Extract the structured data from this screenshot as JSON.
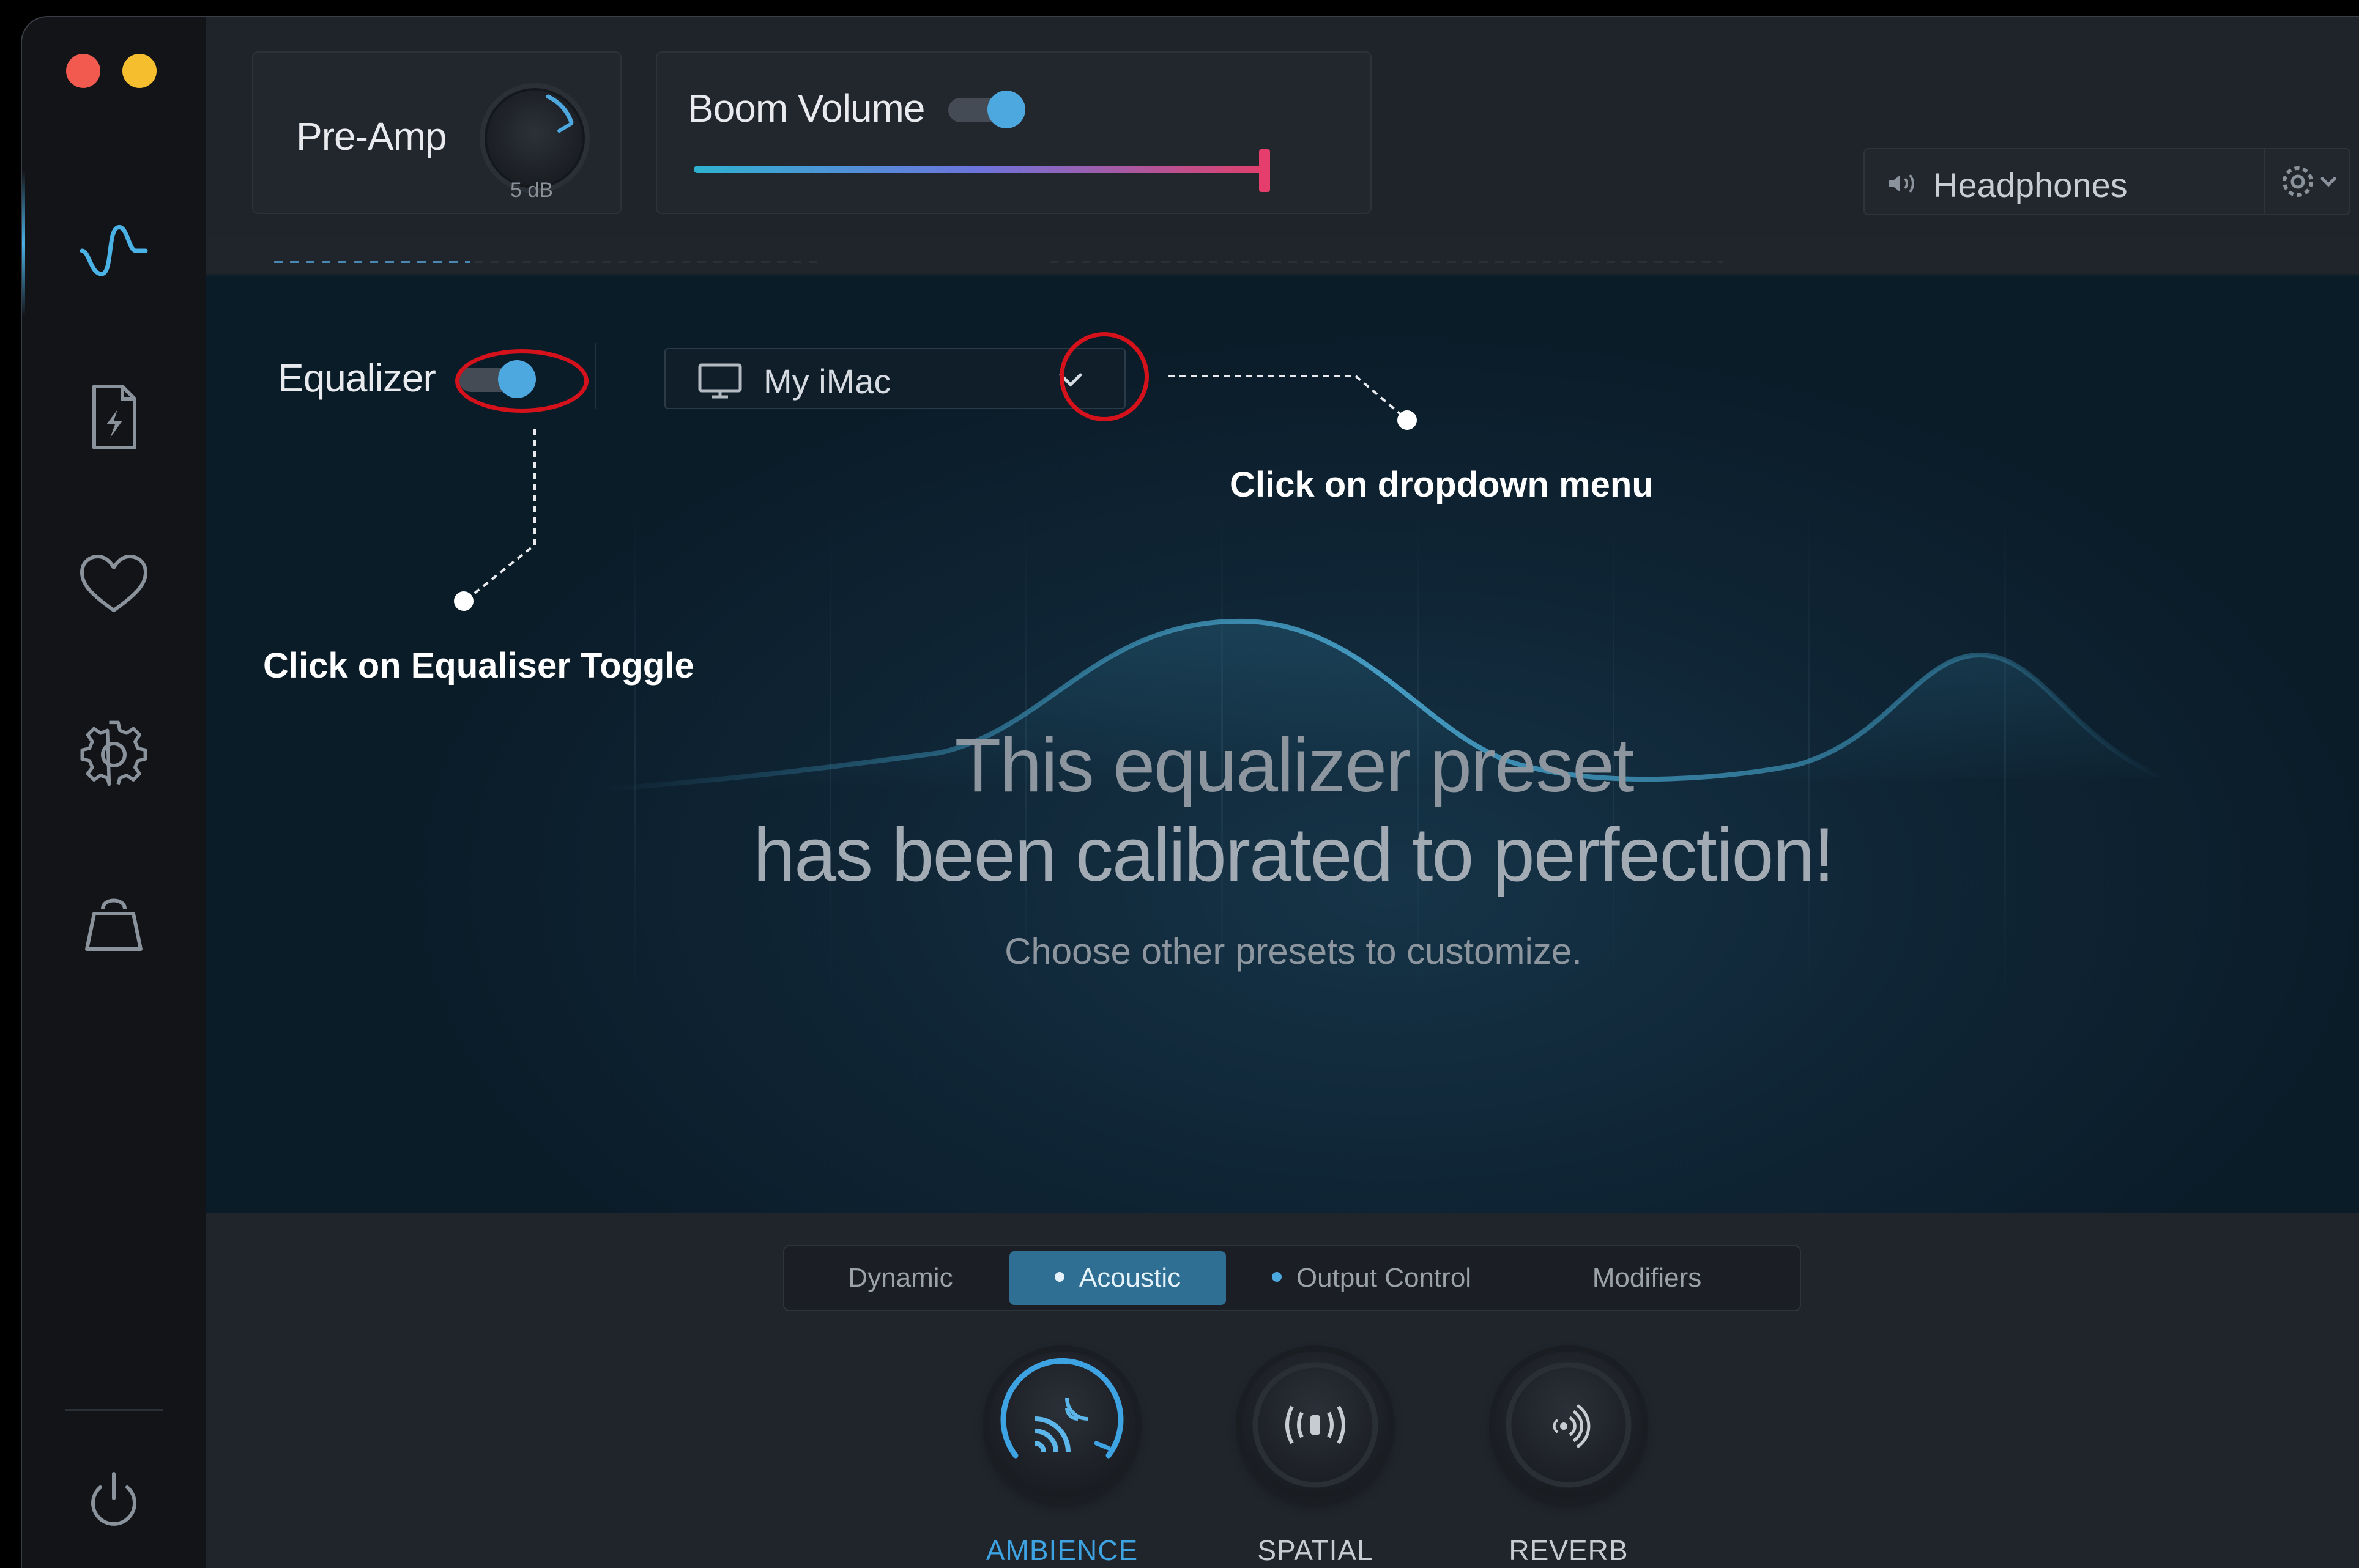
{
  "window": {
    "controls": [
      "close",
      "minimize"
    ]
  },
  "sidebar": {
    "items": [
      {
        "name": "equalizer",
        "icon": "waveform-icon",
        "active": true
      },
      {
        "name": "apps",
        "icon": "file-bolt-icon"
      },
      {
        "name": "favorites",
        "icon": "heart-icon"
      },
      {
        "name": "settings",
        "icon": "gear-icon"
      },
      {
        "name": "store",
        "icon": "shopping-bag-icon"
      }
    ],
    "power_icon": "power-icon"
  },
  "header": {
    "preamp": {
      "label": "Pre-Amp",
      "value": "5 dB"
    },
    "boom_volume": {
      "label": "Boom Volume",
      "enabled": true,
      "level": 0.84
    },
    "output_device": {
      "label": "Headphones",
      "icon": "speaker-icon",
      "settings_icon": "gear-icon"
    }
  },
  "equalizer": {
    "label": "Equalizer",
    "enabled": true,
    "preset_device": "My iMac",
    "preset_icon": "monitor-icon",
    "message_line1": "This equalizer preset",
    "message_line2": "has been calibrated to perfection!",
    "message_sub": "Choose other presets to customize."
  },
  "annotations": {
    "dropdown": "Click on dropdown menu",
    "toggle": "Click on Equaliser Toggle",
    "highlight_color": "#d5121b"
  },
  "bottom": {
    "tabs": [
      {
        "label": "Dynamic",
        "active": false
      },
      {
        "label": "Acoustic",
        "active": true
      },
      {
        "label": "Output Control",
        "active": false
      },
      {
        "label": "Modifiers",
        "active": false
      }
    ],
    "effects": [
      {
        "label": "AMBIENCE",
        "icon": "ambience-icon",
        "active": true
      },
      {
        "label": "SPATIAL",
        "icon": "spatial-audio-icon",
        "active": false
      },
      {
        "label": "REVERB",
        "icon": "reverb-icon",
        "active": false
      }
    ]
  },
  "colors": {
    "accent": "#4ea8e0",
    "boom_gradient_start": "#2fb2d0",
    "boom_gradient_end": "#e0406c"
  }
}
